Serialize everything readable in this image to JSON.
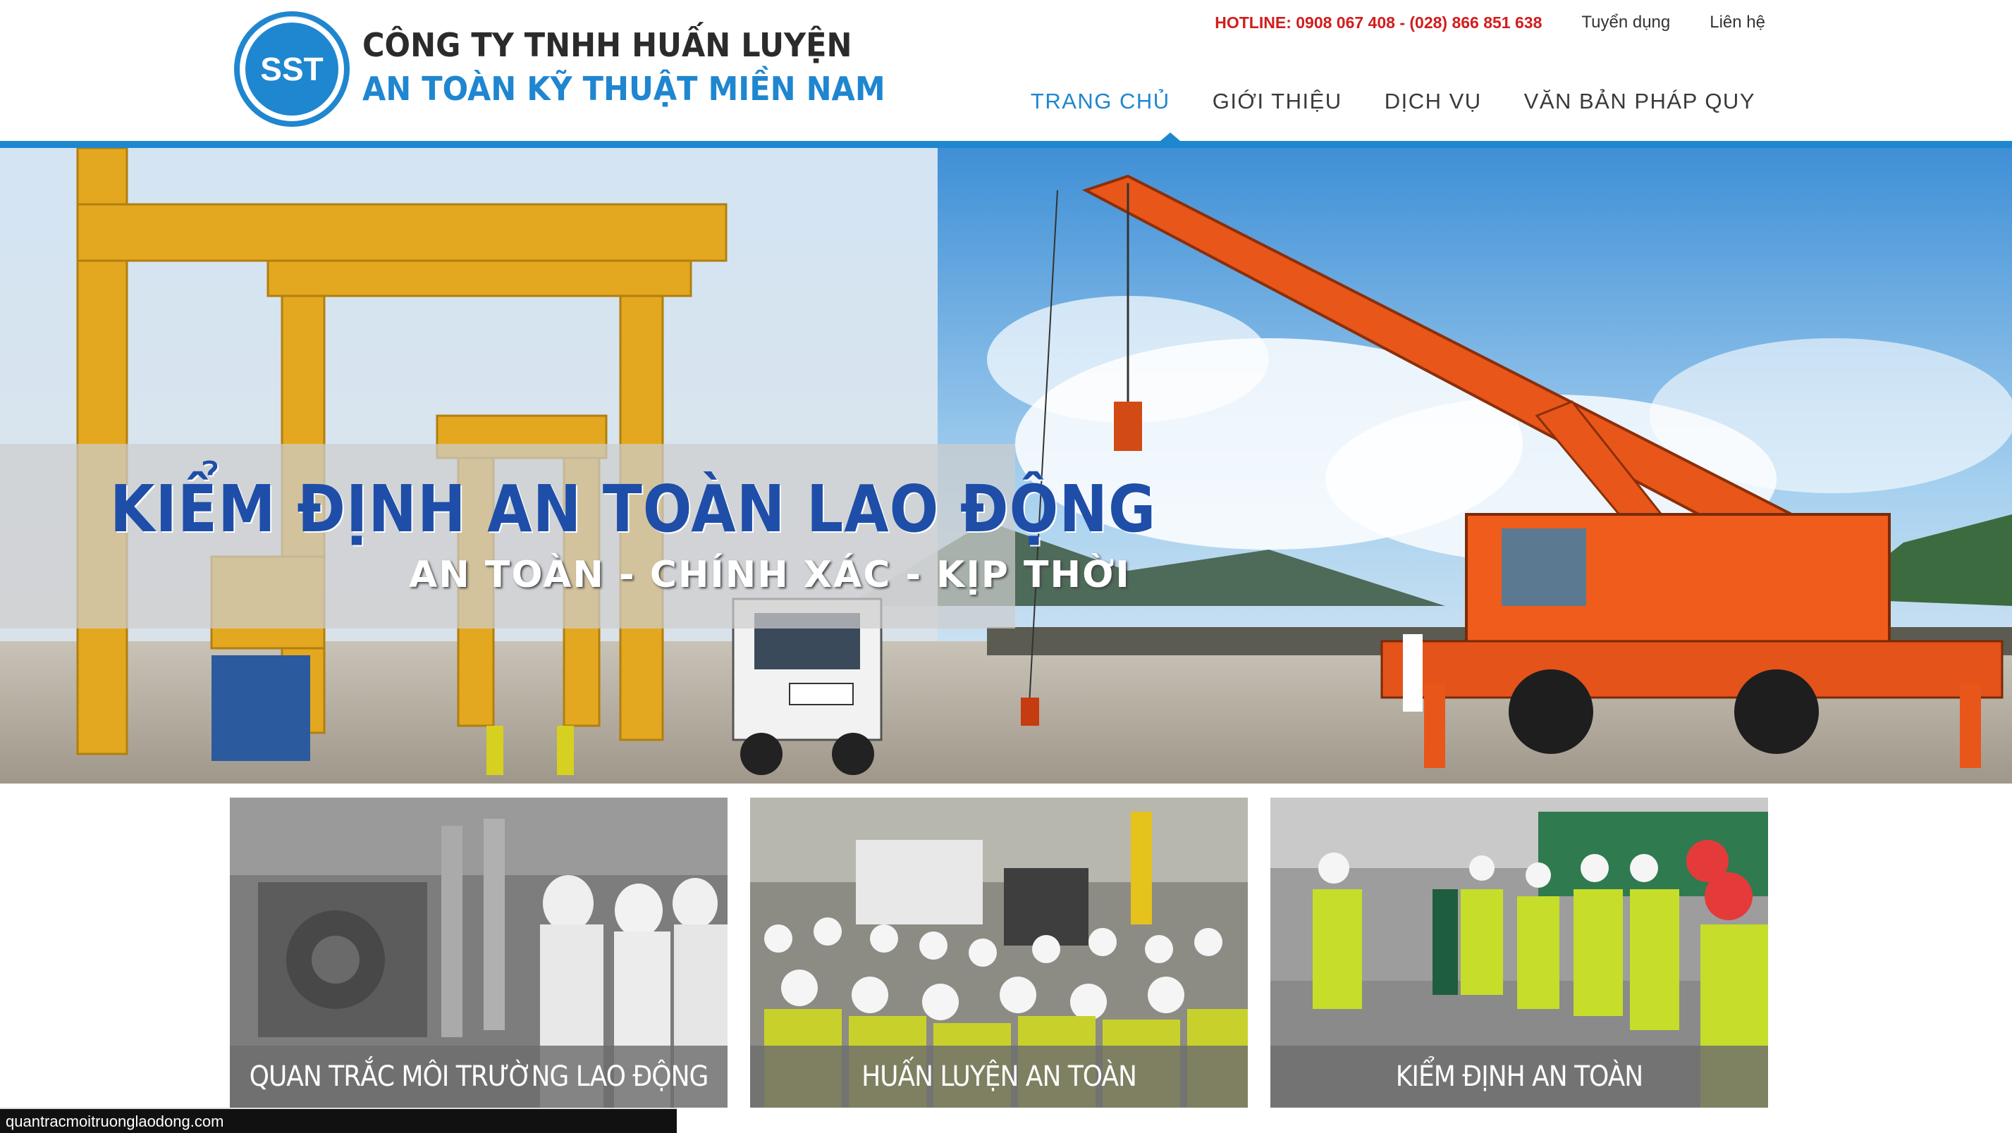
{
  "header": {
    "logo_badge_text": "SST",
    "company_line1": "CÔNG TY TNHH HUẤN LUYỆN",
    "company_line2": "AN TOÀN KỸ THUẬT MIỀN NAM",
    "hotline": "HOTLINE: 0908 067 408 - (028) 866 851 638",
    "top_links": [
      "Tuyển dụng",
      "Liên hệ"
    ],
    "nav": [
      "TRANG CHỦ",
      "GIỚI THIỆU",
      "DỊCH VỤ",
      "VĂN BẢN PHÁP QUY"
    ],
    "active_nav": "TRANG CHỦ"
  },
  "hero": {
    "title": "KIỂM ĐỊNH AN TOÀN LAO ĐỘNG",
    "subtitle": "AN TOÀN - CHÍNH XÁC - KỊP THỜI"
  },
  "cards": [
    {
      "caption": "QUAN TRẮC MÔI TRƯỜNG LAO ĐỘNG"
    },
    {
      "caption": "HUẤN LUYỆN AN TOÀN"
    },
    {
      "caption": "KIỂM ĐỊNH AN TOÀN"
    }
  ],
  "status_url": "quantracmoitruonglaodong.com",
  "colors": {
    "brand_blue": "#1f86d0",
    "hotline_red": "#d21d1d",
    "hero_title_blue": "#1e4ea8"
  }
}
